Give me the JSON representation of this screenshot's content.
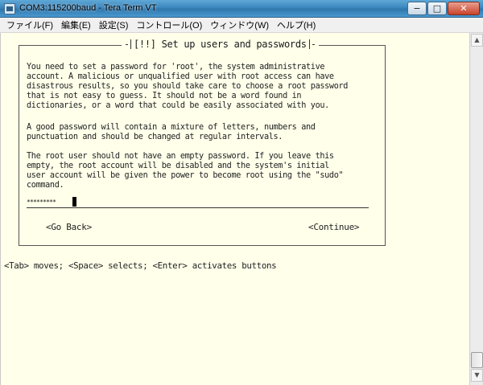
{
  "window": {
    "title": "COM3:115200baud - Tera Term VT",
    "minimize_symbol": "−",
    "maximize_symbol": "□",
    "close_symbol": "✕"
  },
  "menu": {
    "items": [
      {
        "label": "ファイル(F)"
      },
      {
        "label": "編集(E)"
      },
      {
        "label": "設定(S)"
      },
      {
        "label": "コントロール(O)"
      },
      {
        "label": "ウィンドウ(W)"
      },
      {
        "label": "ヘルプ(H)"
      }
    ]
  },
  "dialog": {
    "title": "[!!] Set up users and passwords",
    "paragraph1": "You need to set a password for 'root', the system administrative\naccount. A malicious or unqualified user with root access can have\ndisastrous results, so you should take care to choose a root password\nthat is not easy to guess. It should not be a word found in\ndictionaries, or a word that could be easily associated with you.",
    "paragraph2": "A good password will contain a mixture of letters, numbers and\npunctuation and should be changed at regular intervals.",
    "paragraph3": "The root user should not have an empty password. If you leave this\nempty, the root account will be disabled and the system's initial\nuser account will be given the power to become root using the \"sudo\"\ncommand.",
    "password_mask": "*********",
    "back_button": "<Go Back>",
    "continue_button": "<Continue>"
  },
  "hint": "<Tab> moves; <Space> selects; <Enter> activates buttons",
  "scrollbar": {
    "up_arrow": "▲",
    "down_arrow": "▼"
  }
}
